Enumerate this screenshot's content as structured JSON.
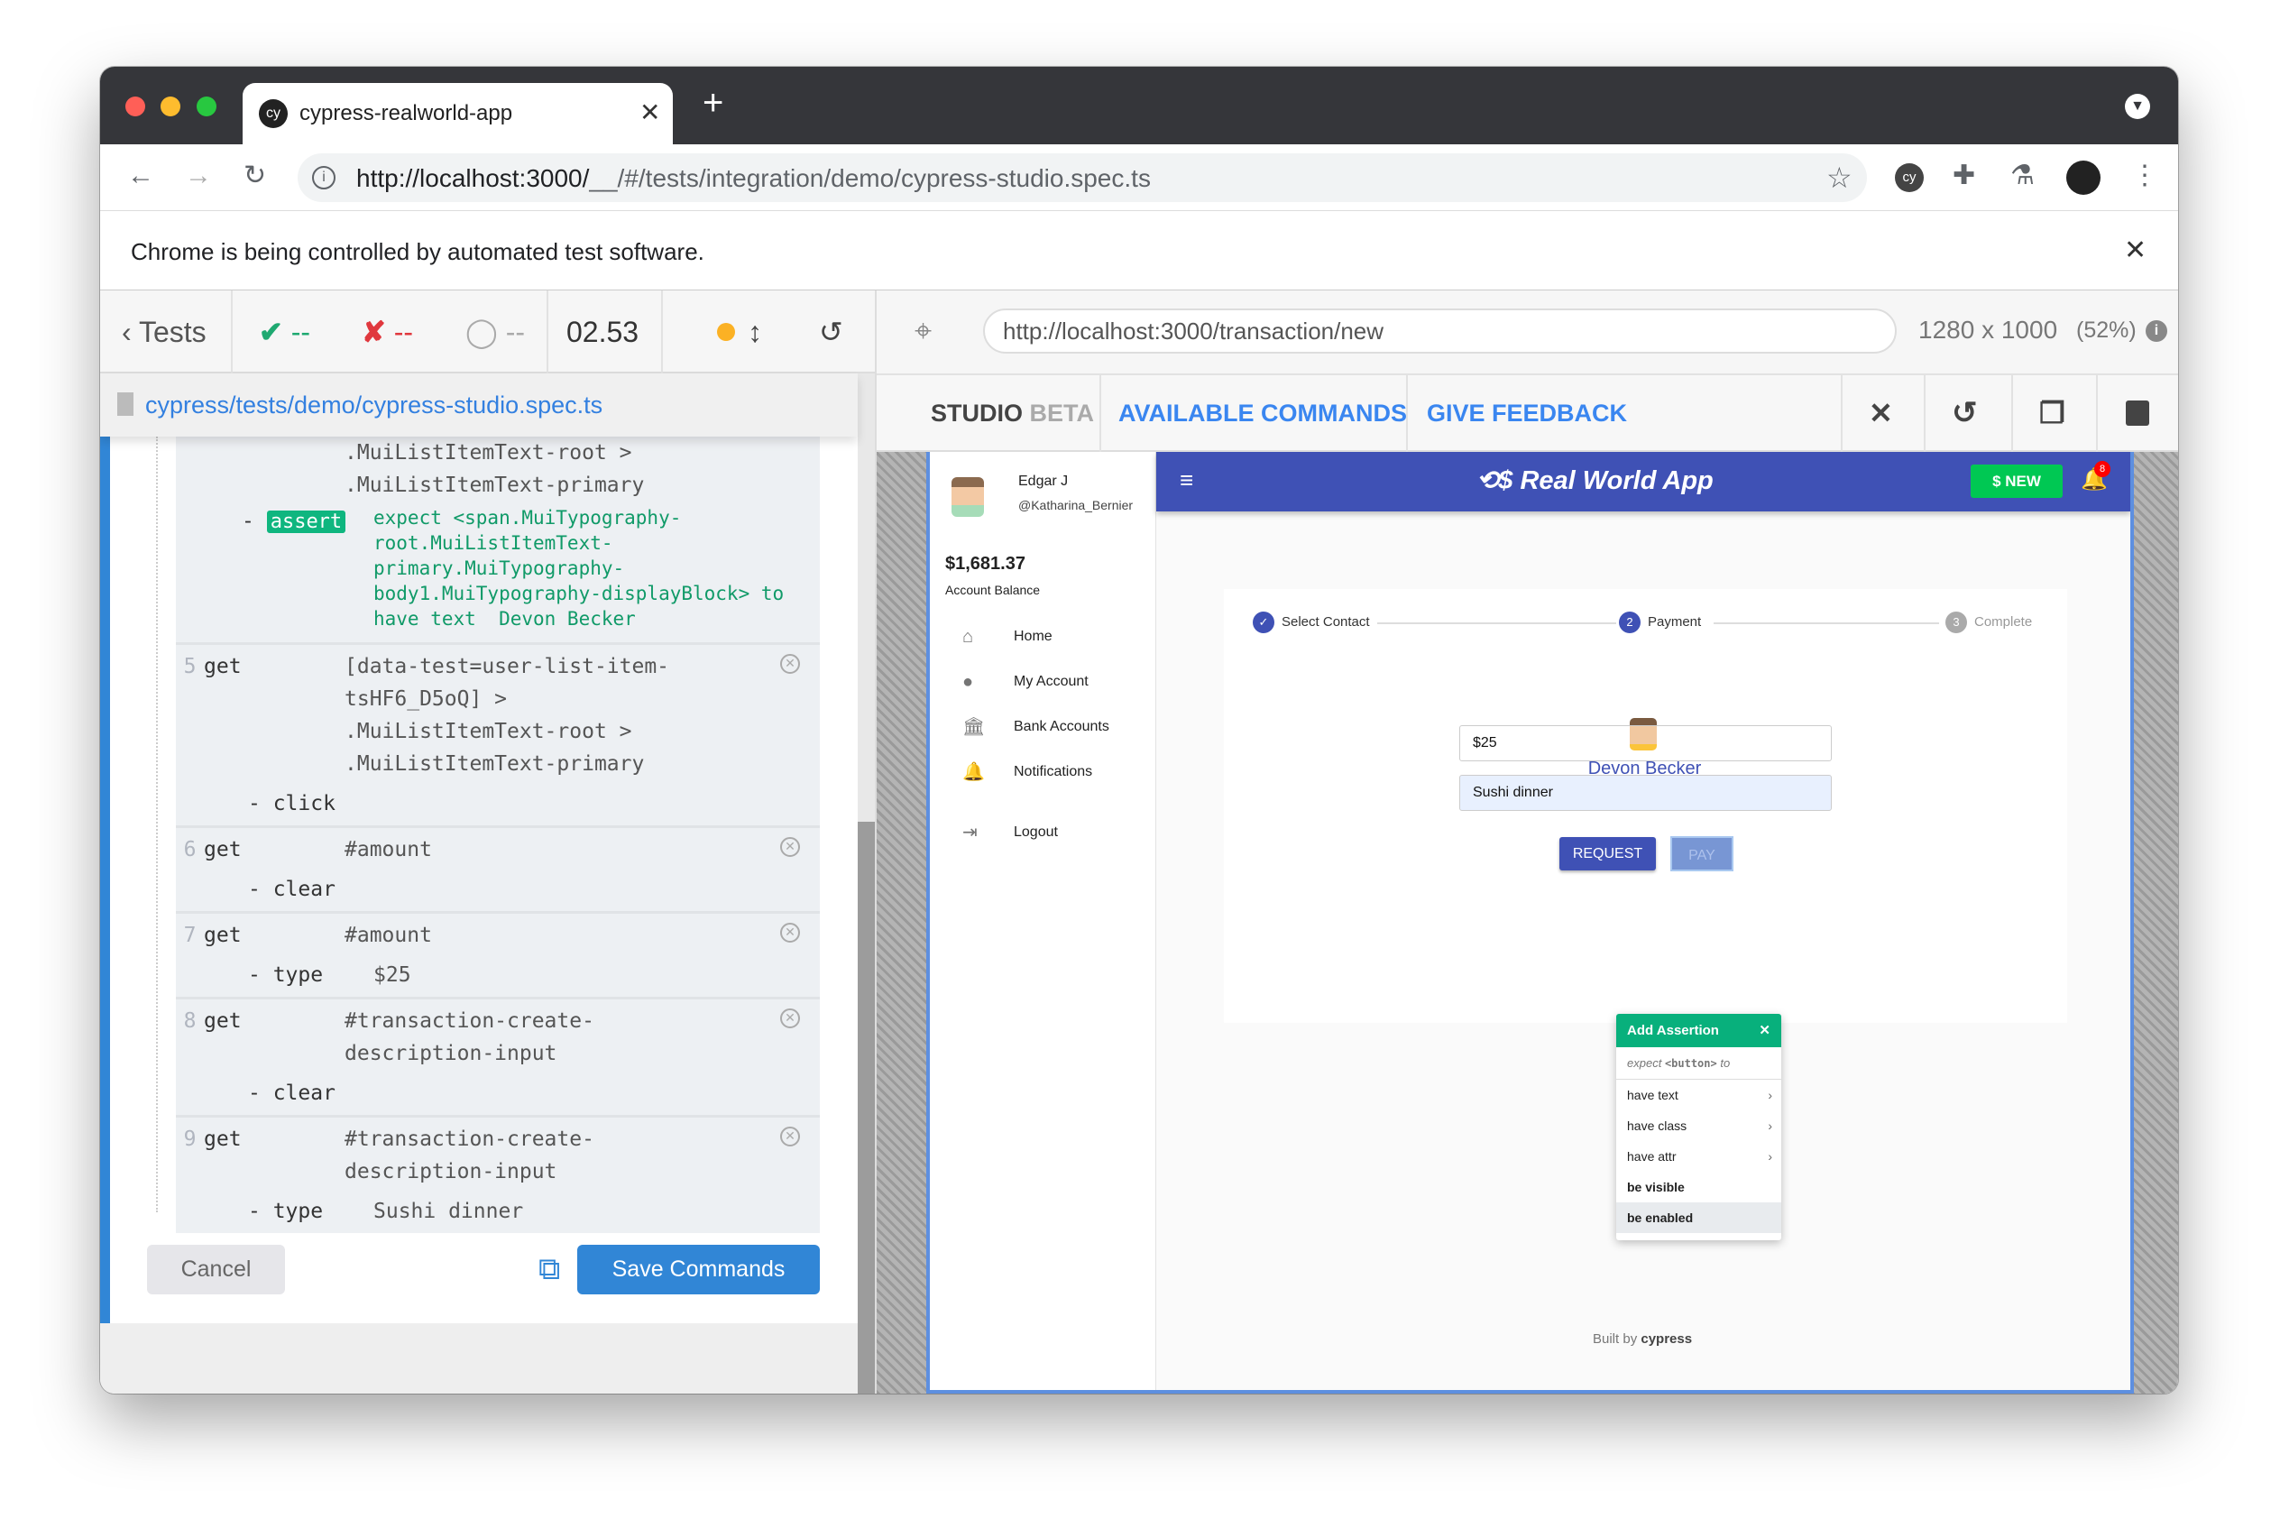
{
  "browser": {
    "tab_title": "cypress-realworld-app",
    "url_host": "http://localhost:3000/",
    "url_path": "__/#/tests/integration/demo/cypress-studio.spec.ts",
    "info_bar": "Chrome is being controlled by automated test software."
  },
  "runner": {
    "tests_label": "Tests",
    "passed": "--",
    "failed": "--",
    "pending": "--",
    "duration": "02.53",
    "spec_path": "cypress/tests/demo/cypress-studio.spec.ts",
    "aut_url": "http://localhost:3000/transaction/new",
    "viewport": "1280 x 1000",
    "scale": "(52%)"
  },
  "studio": {
    "title": "STUDIO",
    "beta": "BETA",
    "available_commands": "AVAILABLE COMMANDS",
    "give_feedback": "GIVE FEEDBACK",
    "cancel": "Cancel",
    "save": "Save Commands"
  },
  "log": {
    "partial": {
      "lines": [
        ".MuiListItemText-root >",
        ".MuiListItemText-primary"
      ],
      "sub_cmd": "assert",
      "assert_message": "expect <span.MuiTypography-\nroot.MuiListItemText-\nprimary.MuiTypography-\nbody1.MuiTypography-displayBlock> to\nhave text  Devon Becker"
    },
    "rows": [
      {
        "num": "5",
        "cmd": "get",
        "value": "[data-test=user-list-item-\ntsHF6_D5oQ] >\n.MuiListItemText-root >\n.MuiListItemText-primary",
        "sub": "- click",
        "sub_value": ""
      },
      {
        "num": "6",
        "cmd": "get",
        "value": "#amount",
        "sub": "- clear",
        "sub_value": ""
      },
      {
        "num": "7",
        "cmd": "get",
        "value": "#amount",
        "sub": "- type",
        "sub_value": "$25"
      },
      {
        "num": "8",
        "cmd": "get",
        "value": "#transaction-create-\ndescription-input",
        "sub": "- clear",
        "sub_value": ""
      },
      {
        "num": "9",
        "cmd": "get",
        "value": "#transaction-create-\ndescription-input",
        "sub": "- type",
        "sub_value": "Sushi dinner"
      }
    ]
  },
  "app": {
    "user_name": "Edgar J",
    "username": "@Katharina_Bernier",
    "balance": "$1,681.37",
    "balance_label": "Account Balance",
    "nav": [
      "Home",
      "My Account",
      "Bank Accounts",
      "Notifications",
      "Logout"
    ],
    "title": "Real World App",
    "new_button": "$ NEW",
    "notification_count": "8",
    "steps": [
      {
        "num": "✓",
        "label": "Select Contact"
      },
      {
        "num": "2",
        "label": "Payment"
      },
      {
        "num": "3",
        "label": "Complete"
      }
    ],
    "contact": "Devon Becker",
    "amount": "$25",
    "description": "Sushi dinner",
    "request": "REQUEST",
    "pay": "PAY",
    "built_by": "Built by",
    "brand": "cypress"
  },
  "assertion": {
    "title": "Add Assertion",
    "expect_prefix": "expect",
    "element": "<button>",
    "suffix": "to",
    "options": [
      "have text",
      "have class",
      "have attr",
      "be visible",
      "be enabled"
    ]
  },
  "colors": {
    "accent": "#3186d6",
    "app_header": "#3f51b5",
    "assert_green": "#0fb67f",
    "new_green": "#00c853"
  }
}
